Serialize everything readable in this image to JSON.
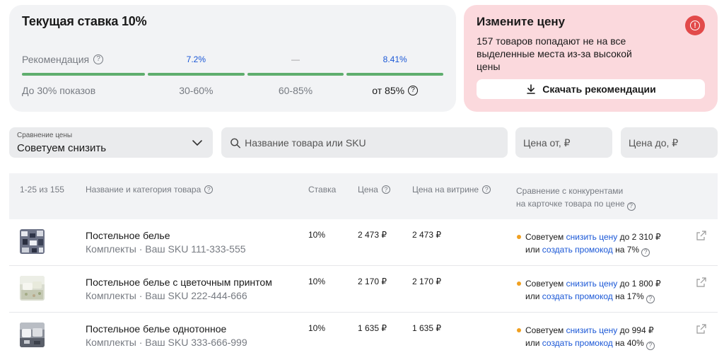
{
  "rate_card": {
    "title": "Текущая ставка 10%",
    "recommendation_label": "Рекомендация",
    "levels": [
      {
        "pct": "7.2%",
        "range": "30-60%"
      },
      {
        "pct": "—",
        "range": "60-85%"
      },
      {
        "pct": "8.41%",
        "range": "от 85%"
      }
    ],
    "first_range": "До 30% показов"
  },
  "alert_card": {
    "title": "Измените цену",
    "text": "157 товаров попадают не на все выделенные места из-за высокой цены",
    "button_label": "Скачать рекомендации"
  },
  "filters": {
    "compare_label": "Сравнение цены",
    "compare_value": "Советуем снизить",
    "search_placeholder": "Название товара или SKU",
    "price_from_placeholder": "Цена от, ₽",
    "price_to_placeholder": "Цена до, ₽"
  },
  "table": {
    "headers": {
      "count": "1-25 из 155",
      "name": "Название и категория товара",
      "rate": "Ставка",
      "price": "Цена",
      "shelf_price": "Цена на витрине",
      "compare_line1": "Сравнение с конкурентами",
      "compare_line2": "на карточке товара по цене"
    },
    "rows": [
      {
        "name": "Постельное белье",
        "category": "Комплекты · Ваш SKU 111-333-555",
        "rate": "10%",
        "price": "2 473 ₽",
        "shelf": "2 473 ₽",
        "advice_prefix": "Советуем",
        "advice_link": "снизить цену",
        "advice_to": "до 2 310 ₽",
        "or": "или",
        "promo_link": "создать промокод",
        "promo_to": "на 7%"
      },
      {
        "name": "Постельное белье с цветочным принтом",
        "category": "Комплекты · Ваш SKU 222-444-666",
        "rate": "10%",
        "price": "2 170 ₽",
        "shelf": "2 170 ₽",
        "advice_prefix": "Советуем",
        "advice_link": "снизить цену",
        "advice_to": "до 1 800 ₽",
        "or": "или",
        "promo_link": "создать промокод",
        "promo_to": "на 17%"
      },
      {
        "name": "Постельное белье однотонное",
        "category": "Комплекты · Ваш SKU 333-666-999",
        "rate": "10%",
        "price": "1 635 ₽",
        "shelf": "1 635 ₽",
        "advice_prefix": "Советуем",
        "advice_link": "снизить цену",
        "advice_to": "до 994 ₽",
        "or": "или",
        "promo_link": "создать промокод",
        "promo_to": "на 40%"
      }
    ]
  },
  "colors": {
    "accent": "#1a57d6",
    "bar": "#5fae6e",
    "alert_bg": "#fbd9dd",
    "alert_icon": "#e24a4a",
    "dot": "#f0a020"
  }
}
